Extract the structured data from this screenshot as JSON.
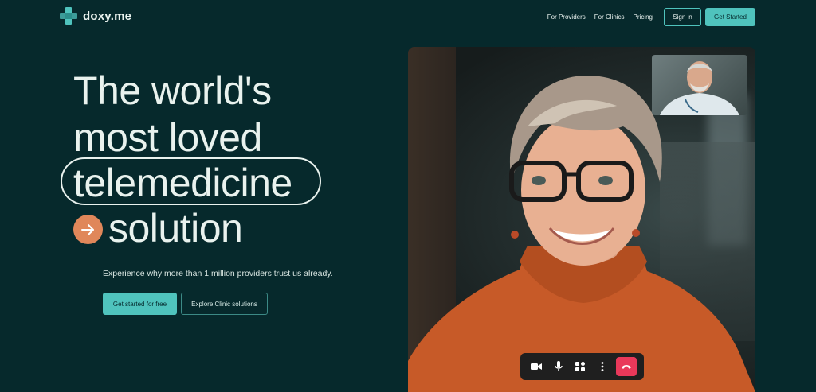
{
  "header": {
    "logo_text": "doxy.me",
    "nav": [
      "For Providers",
      "For Clinics",
      "Pricing"
    ],
    "sign_in": "Sign in",
    "get_started": "Get Started"
  },
  "hero": {
    "line1": "The world's",
    "line2": "most loved",
    "line3": "telemedicine",
    "line4": "solution",
    "subtitle": "Experience why more than 1 million providers trust us already.",
    "cta_primary": "Get started for free",
    "cta_secondary": "Explore Clinic solutions"
  },
  "video_call": {
    "icons": [
      "camera-icon",
      "microphone-icon",
      "apps-icon",
      "more-icon",
      "end-call-icon"
    ]
  },
  "colors": {
    "background": "#06292c",
    "accent": "#4fc3bd",
    "arrow": "#e0875a",
    "end_call": "#e9385a"
  }
}
